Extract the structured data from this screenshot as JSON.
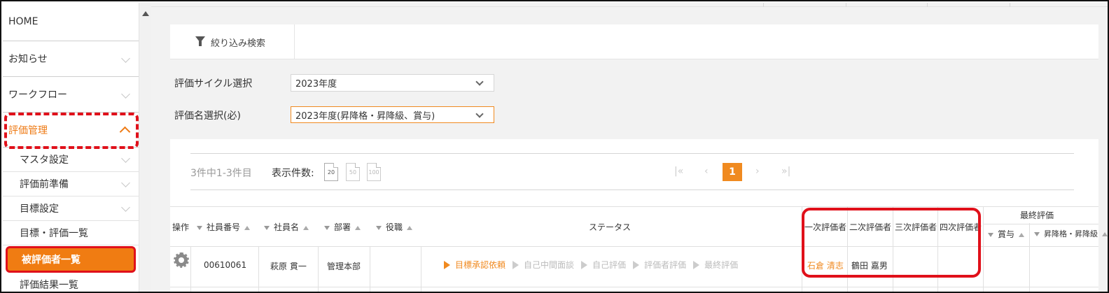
{
  "sidebar": {
    "items": [
      {
        "label": "HOME"
      },
      {
        "label": "お知らせ"
      },
      {
        "label": "ワークフロー"
      },
      {
        "label": "評価管理"
      }
    ],
    "sub_items": [
      {
        "label": "マスタ設定"
      },
      {
        "label": "評価前準備"
      },
      {
        "label": "目標設定"
      },
      {
        "label": "目標・評価一覧"
      },
      {
        "label": "被評価者一覧"
      },
      {
        "label": "評価結果一覧"
      }
    ]
  },
  "filter": {
    "label": "絞り込み検索"
  },
  "form": {
    "cycle_label": "評価サイクル選択",
    "cycle_value": "2023年度",
    "name_label": "評価名選択(必)",
    "name_value": "2023年度(昇降格・昇降級、賞与)"
  },
  "pagination": {
    "count_text": "3件中1-3件目",
    "per_page_label": "表示件数:",
    "per_page_options": [
      "20",
      "50",
      "100"
    ],
    "first": "|«",
    "prev": "‹",
    "current": "1",
    "next": "›",
    "last": "»|"
  },
  "table": {
    "headers": {
      "op": "操作",
      "emp_no": "社員番号",
      "emp_name": "社員名",
      "dept": "部署",
      "role": "役職",
      "status": "ステータス",
      "eval1": "一次評価者",
      "eval2": "二次評価者",
      "eval3": "三次評価者",
      "eval4": "四次評価者",
      "final": "最終評価",
      "bonus": "賞与",
      "promo": "昇降格・昇降級"
    },
    "rows": [
      {
        "emp_no": "00610061",
        "emp_name": "萩原 貫一",
        "dept": "管理本部",
        "role": "",
        "status_steps": [
          "目標承認依頼",
          "自己中間面談",
          "自己評価",
          "評価者評価",
          "最終評価"
        ],
        "active_step": 0,
        "eval1": "石倉 清志",
        "eval2": "鶴田 嘉男",
        "eval3": "",
        "eval4": ""
      }
    ]
  },
  "colors": {
    "accent": "#f08a20",
    "highlight_red": "#e0101a"
  }
}
